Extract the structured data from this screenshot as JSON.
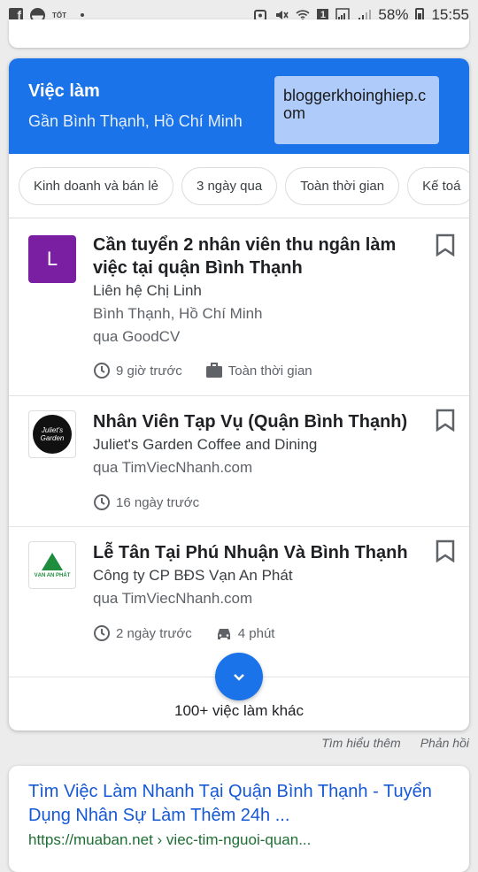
{
  "status_bar": {
    "left_icons": [
      "facebook-icon",
      "notification-icon",
      "tot-app-icon",
      "dot-icon"
    ],
    "tot_label": "TỐT",
    "battery_percent": "58%",
    "time": "15:55",
    "sim_label": "1"
  },
  "job_card": {
    "title": "Việc làm",
    "subtitle": "Gần Bình Thạnh, Hồ Chí Minh",
    "watermark": "bloggerkhoinghiep.com",
    "chips": [
      "Kinh doanh và bán lẻ",
      "3 ngày qua",
      "Toàn thời gian",
      "Kế toá"
    ],
    "jobs": [
      {
        "logo_letter": "L",
        "title": "Cần tuyển 2 nhân viên thu ngân làm việc tại quận Bình Thạnh",
        "company": "Liên hệ Chị Linh",
        "location": "Bình Thạnh, Hồ Chí Minh",
        "source": "qua GoodCV",
        "posted": "9 giờ trước",
        "job_type": "Toàn thời gian"
      },
      {
        "logo_text": "Juliet's Garden",
        "title": "Nhân Viên Tạp Vụ (Quận Bình Thạnh)",
        "company": "Juliet's Garden Coffee and Dining",
        "source": "qua TimViecNhanh.com",
        "posted": "16 ngày trước"
      },
      {
        "logo_text": "VẠN AN PHÁT",
        "title": "Lễ Tân Tại Phú Nhuận Và Bình Thạnh",
        "company": "Công ty CP BĐS Vạn An Phát",
        "source": "qua TimViecNhanh.com",
        "posted": "2 ngày trước",
        "commute": "4 phút"
      }
    ],
    "more_jobs": "100+ việc làm khác"
  },
  "footer_links": [
    "Tìm hiểu thêm",
    "Phản hồi"
  ],
  "result": {
    "title": "Tìm Việc Làm Nhanh Tại Quận Bình Thạnh - Tuyển Dụng Nhân Sự Làm Thêm 24h ...",
    "url": "https://muaban.net › viec-tim-nguoi-quan..."
  },
  "colors": {
    "accent": "#1a73e8",
    "watermark_bg": "#aecbfa",
    "logo_purple": "#7b1fa2",
    "link": "#1558d6",
    "url_green": "#1e6e34"
  }
}
